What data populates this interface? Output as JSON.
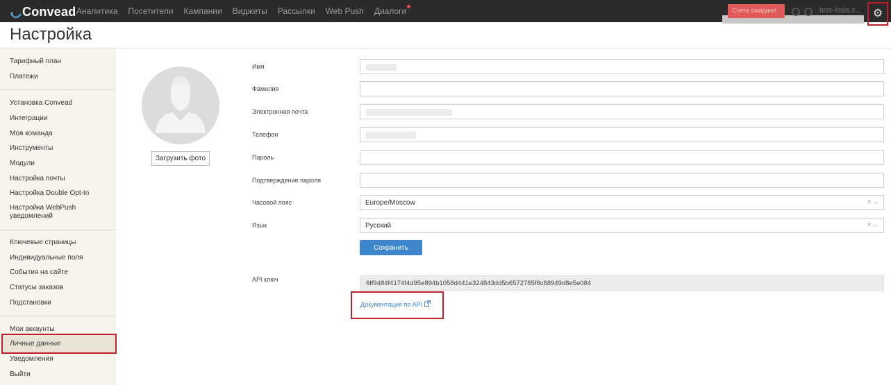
{
  "app": {
    "brand": "Convead",
    "brand_color": "#2b2b2b",
    "accent_color": "#3d86cc",
    "highlight_color": "#c0202a"
  },
  "nav": {
    "items": [
      "Аналитика",
      "Посетители",
      "Кампании",
      "Виджеты",
      "Рассылки",
      "Web Push",
      "Диалоги"
    ]
  },
  "topbar_right": {
    "pending_label": "Счета ожидают",
    "site_name": "test-insis.c...",
    "help_icon": "question-circle",
    "search_icon": "search",
    "settings_icon": "gear"
  },
  "page": {
    "title": "Настройка"
  },
  "sidebar": {
    "group1": [
      "Тарифный план",
      "Платежи"
    ],
    "group2": [
      "Установка Convead",
      "Интеграции",
      "Моя команда",
      "Инструменты",
      "Модули",
      "Настройка почты",
      "Настройка Double Opt-In",
      "Настройка WebPush уведомлений"
    ],
    "group3": [
      "Ключевые страницы",
      "Индивидуальные поля",
      "События на сайте",
      "Статусы заказов",
      "Подстановки"
    ],
    "group4": [
      "Мои аккаунты",
      "Личные данные",
      "Уведомления",
      "Выйти"
    ],
    "active": "Личные данные"
  },
  "profile": {
    "upload_photo": "Загрузить фото"
  },
  "form": {
    "first_name_label": "Имя",
    "last_name_label": "Фамилия",
    "email_label": "Электронная почта",
    "phone_label": "Телефон",
    "password_label": "Пароль",
    "password_confirm_label": "Подтверждение пароля",
    "timezone_label": "Часовой пояс",
    "timezone_value": "Europe/Moscow",
    "language_label": "Язык",
    "language_value": "Русский",
    "clear_symbol": "×",
    "chevron_symbol": "⌵",
    "save_label": "Сохранить",
    "api_key_label": "API ключ",
    "api_key_value": "6ff9484f4174f4d95e894b1058d441e324843dd5b6572785f8c88949d8e5e084",
    "api_docs_link": "Документация по API"
  }
}
